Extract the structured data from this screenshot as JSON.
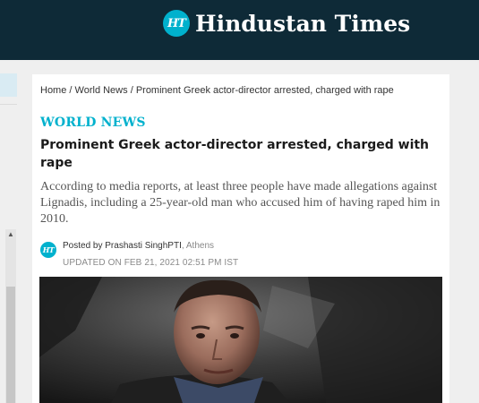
{
  "header": {
    "logo_badge": "HT",
    "site_name": "Hindustan Times",
    "background_color": "#0e2a37",
    "accent_color": "#00b1cd"
  },
  "breadcrumb": {
    "items": [
      "Home",
      "World News",
      "Prominent Greek actor-director arrested, charged with rape"
    ],
    "separator": "/"
  },
  "article": {
    "section": "WORLD NEWS",
    "title": "Prominent Greek actor-director arrested, charged with rape",
    "summary": "According to media reports, at least three people have made allegations against Lignadis, including a 25-year-old man who accused him of having raped him in 2010.",
    "byline_prefix": "Posted by ",
    "author": "Prashasti SinghPTI",
    "location": ", Athens",
    "updated": "UPDATED ON FEB 21, 2021 02:51 PM IST",
    "author_badge": "HT"
  },
  "icons": {
    "scroll_up": "scroll-up-arrow-icon",
    "logo": "ht-logo-icon"
  }
}
